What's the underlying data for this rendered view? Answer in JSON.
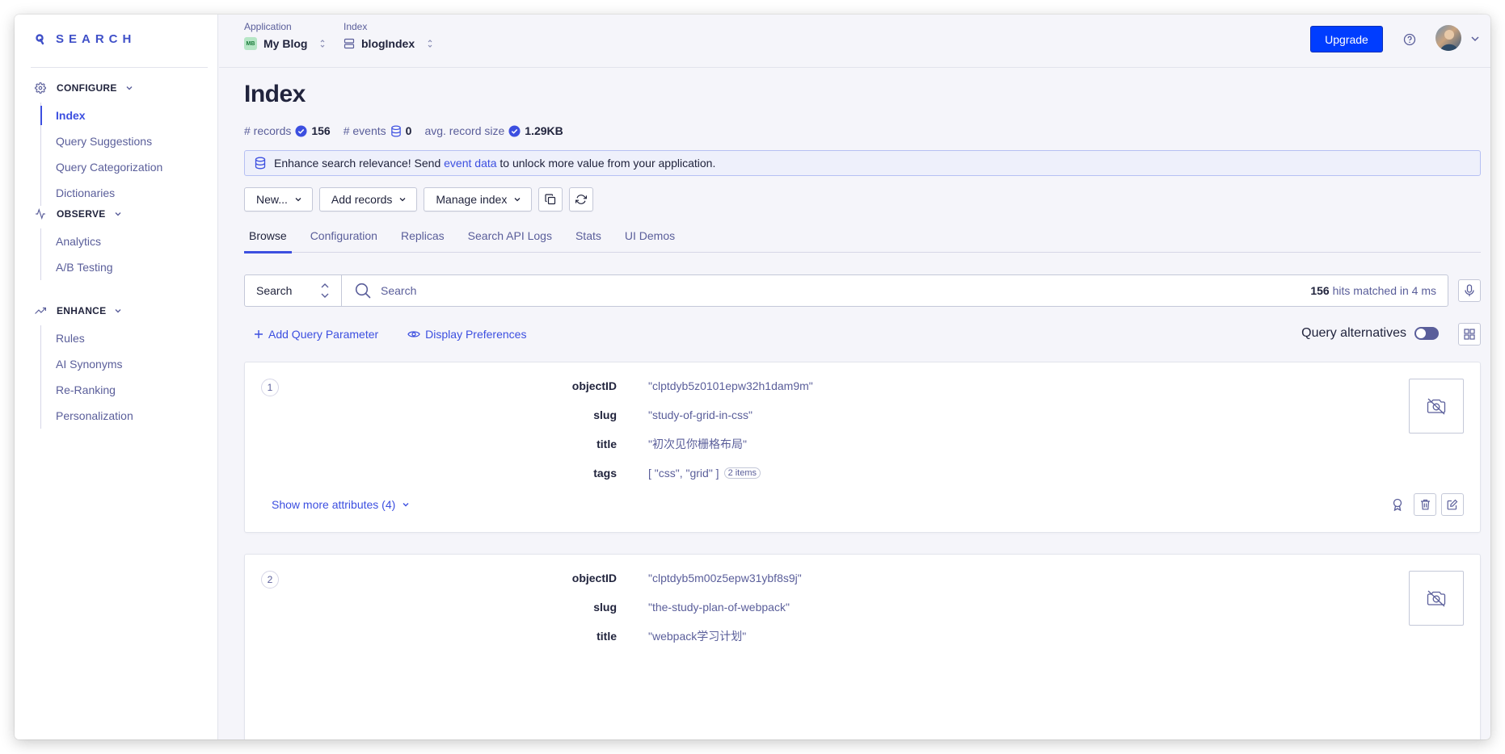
{
  "brand": {
    "name": "SEARCH",
    "color": "#3f50c8"
  },
  "sidebar": {
    "groups": [
      {
        "label": "CONFIGURE",
        "icon": "gear-icon",
        "items": [
          {
            "label": "Index",
            "active": true
          },
          {
            "label": "Query Suggestions"
          },
          {
            "label": "Query Categorization"
          },
          {
            "label": "Dictionaries"
          }
        ]
      },
      {
        "label": "OBSERVE",
        "icon": "activity-icon",
        "items": [
          {
            "label": "Analytics"
          },
          {
            "label": "A/B Testing"
          }
        ]
      },
      {
        "label": "ENHANCE",
        "icon": "trending-up-icon",
        "items": [
          {
            "label": "Rules"
          },
          {
            "label": "AI Synonyms"
          },
          {
            "label": "Re-Ranking"
          },
          {
            "label": "Personalization"
          }
        ]
      }
    ]
  },
  "topbar": {
    "application_label": "Application",
    "application_badge": "MB",
    "application_value": "My Blog",
    "index_label": "Index",
    "index_value": "blogIndex",
    "upgrade_label": "Upgrade",
    "accent_color": "#003dff"
  },
  "page": {
    "title": "Index",
    "stats": [
      {
        "label": "# records",
        "icon": "check-badge-icon",
        "value": "156"
      },
      {
        "label": "# events",
        "icon": "database-icon",
        "value": "0"
      },
      {
        "label": "avg. record size",
        "icon": "check-badge-icon",
        "value": "1.29KB"
      }
    ],
    "banner": {
      "before": "Enhance search relevance! Send ",
      "link": "event data",
      "after": " to unlock more value from your application."
    },
    "toolbar": {
      "new_label": "New...",
      "add_records_label": "Add records",
      "manage_index_label": "Manage index"
    },
    "tabs": [
      "Browse",
      "Configuration",
      "Replicas",
      "Search API Logs",
      "Stats",
      "UI Demos"
    ],
    "active_tab": "Browse",
    "search": {
      "mode": "Search",
      "placeholder": "Search",
      "hits_count": "156",
      "hits_text": " hits matched in 4 ms"
    },
    "add_query_parameter": "Add Query Parameter",
    "display_preferences": "Display Preferences",
    "query_alternatives": "Query alternatives",
    "query_alternatives_on": false
  },
  "records": [
    {
      "rank": "1",
      "attributes": [
        {
          "key": "objectID",
          "value": "\"clptdyb5z0101epw32h1dam9m\""
        },
        {
          "key": "slug",
          "value": "\"study-of-grid-in-css\""
        },
        {
          "key": "title",
          "value": "\"初次见你栅格布局\""
        },
        {
          "key": "tags",
          "value": "[ \"css\", \"grid\" ]",
          "pill": "2 items"
        }
      ],
      "show_more": "Show more attributes (4)"
    },
    {
      "rank": "2",
      "attributes": [
        {
          "key": "objectID",
          "value": "\"clptdyb5m00z5epw31ybf8s9j\""
        },
        {
          "key": "slug",
          "value": "\"the-study-plan-of-webpack\""
        },
        {
          "key": "title",
          "value": "\"webpack学习计划\""
        }
      ]
    }
  ]
}
